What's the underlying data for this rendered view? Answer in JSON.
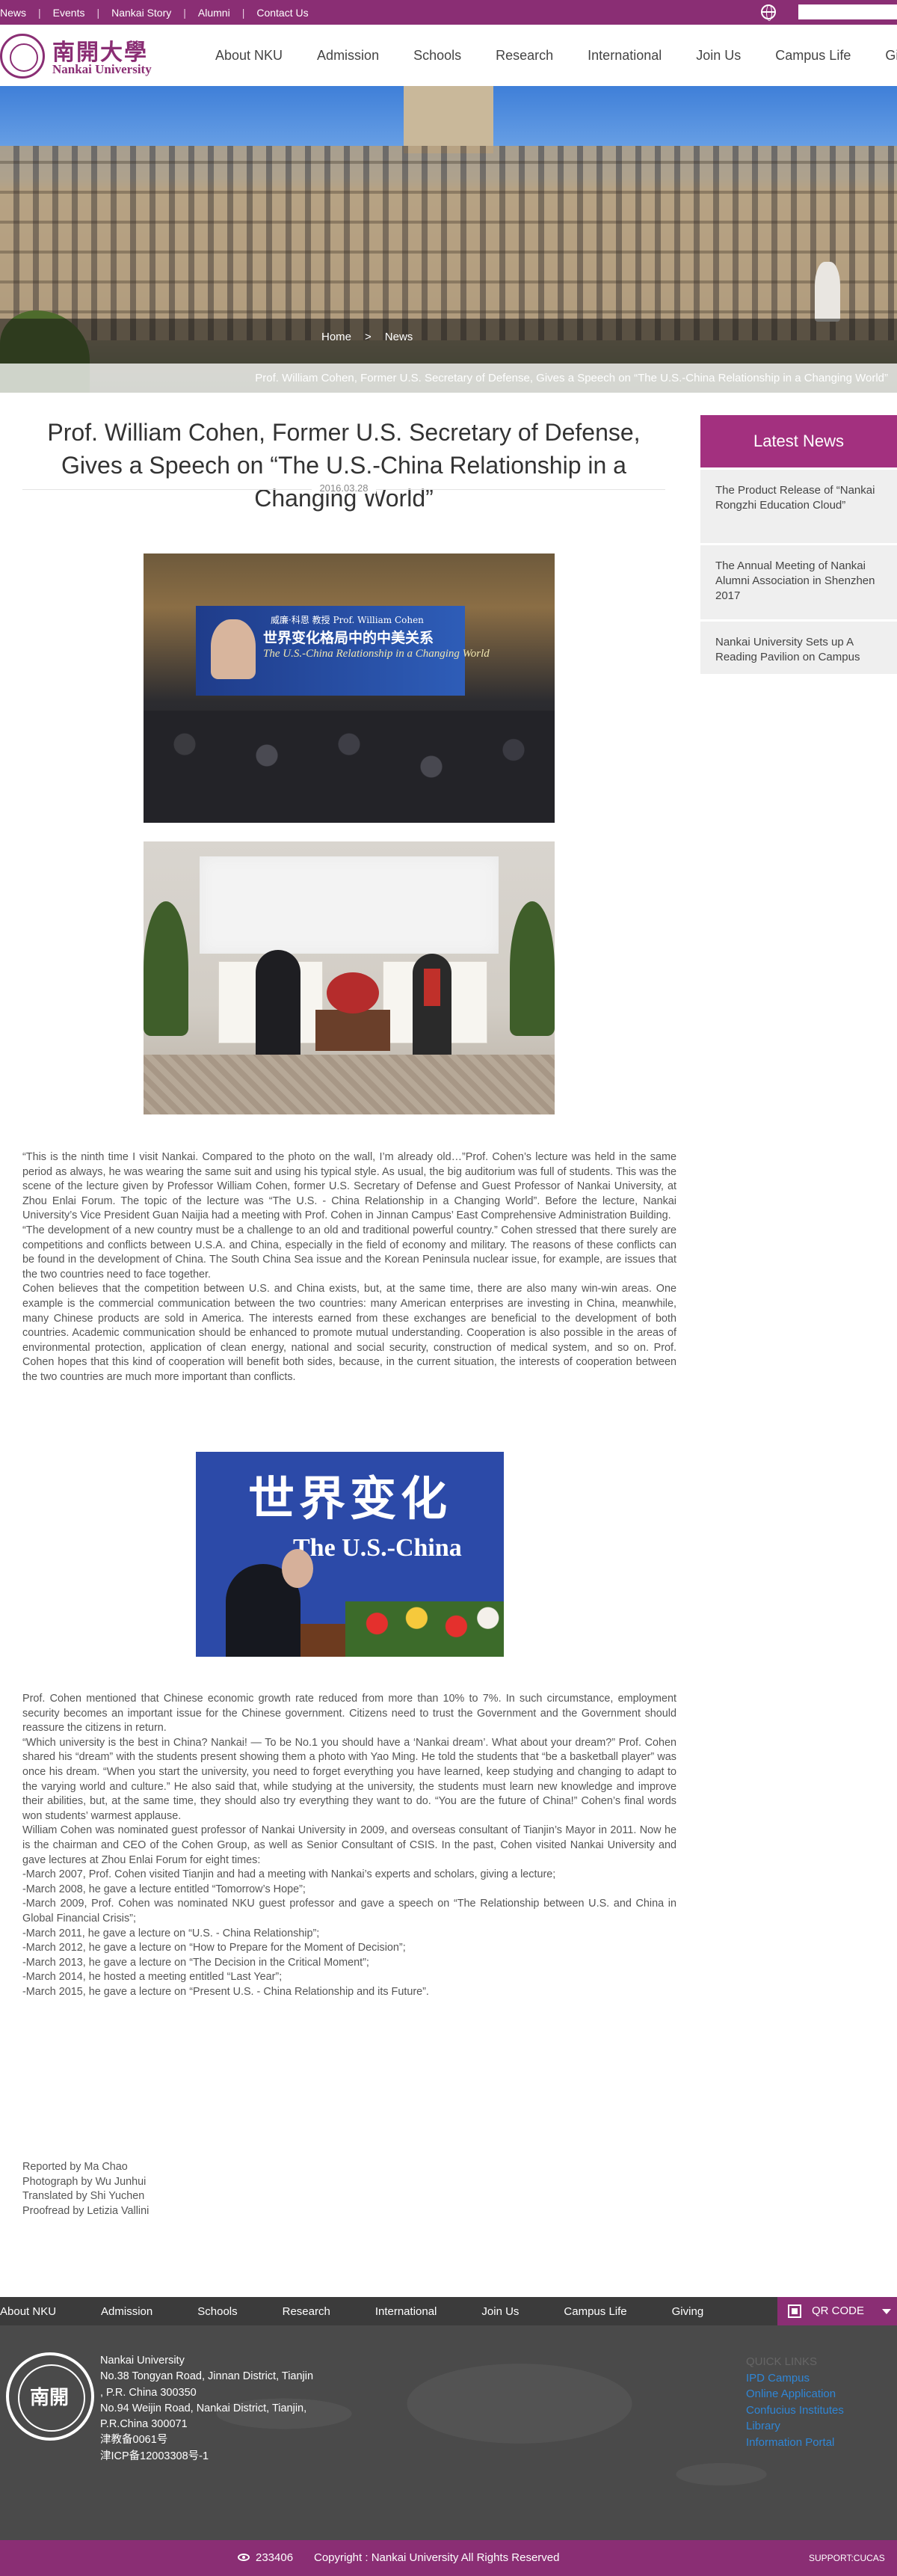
{
  "topbar": {
    "links": [
      "News",
      "Events",
      "Nankai Story",
      "Alumni",
      "Contact Us"
    ],
    "globe_icon": "globe-icon",
    "search_placeholder": ""
  },
  "header": {
    "logo_cn": "南開大學",
    "logo_en": "Nankai University",
    "nav": [
      "About NKU",
      "Admission",
      "Schools",
      "Research",
      "International",
      "Join Us",
      "Campus Life",
      "Giving"
    ]
  },
  "hero": {
    "breadcrumb": [
      "Home",
      ">",
      "News"
    ],
    "ghost_title": "Prof. William Cohen, Former U.S. Secretary of Defense, Gives a Speech on “The U.S.-China Relationship in a Changing World”"
  },
  "article": {
    "title": "Prof. William Cohen, Former U.S. Secretary of Defense, Gives a Speech on “The U.S.-China Relationship in a Changing World”",
    "date": "2016.03.28",
    "photo1_sign_small": "威廉·科恩 教授  Prof. William Cohen",
    "photo1_sign_cn": "世界变化格局中的中美关系",
    "photo1_sign_en": "The U.S.-China Relationship in a Changing World",
    "photo3_cn": "世界变化",
    "photo3_en": "The U.S.-China",
    "paragraphs_1": [
      "“This is the ninth time I visit Nankai. Compared to the photo on the wall, I’m already old…”Prof. Cohen’s lecture was held in the same period as always, he was wearing the same suit and using his typical style. As usual, the big auditorium was full of students. This was the scene of the lecture given by Professor William Cohen, former U.S. Secretary of Defense and Guest Professor of Nankai University, at Zhou Enlai Forum. The topic of the lecture was “The U.S. - China Relationship in a Changing World”. Before the lecture, Nankai University’s Vice President Guan Naijia had a meeting with Prof. Cohen in Jinnan Campus’ East Comprehensive Administration Building.",
      "“The development of a new country must be a challenge to an old and traditional powerful country.” Cohen stressed that there surely are competitions and conflicts between U.S.A. and China, especially in the field of economy and military. The reasons of these conflicts can be found in the development of China. The South China Sea issue and the Korean Peninsula nuclear issue, for example, are issues that the two countries need to face together.",
      "Cohen believes that the competition between U.S. and China exists, but, at the same time, there are also many win-win areas. One example is the commercial communication between the two countries: many American enterprises are investing in China, meanwhile, many Chinese products are sold in America. The interests earned from these exchanges are beneficial to the development of both countries. Academic communication should be enhanced to promote mutual understanding. Cooperation is also possible in the areas of environmental protection, application of clean energy, national and social security, construction of medical system, and so on. Prof. Cohen hopes that this kind of cooperation will benefit both sides, because, in the current situation, the interests of cooperation between the two countries are much more important than conflicts."
    ],
    "paragraphs_2": [
      "Prof. Cohen mentioned that Chinese economic growth rate reduced from more than 10% to 7%. In such circumstance, employment security becomes an important issue for the Chinese government. Citizens need to trust the Government and the Government should reassure the citizens in return.",
      "“Which university is the best in China? Nankai! — To be No.1 you should have a ‘Nankai dream’. What about your dream?” Prof. Cohen shared his “dream” with the students present showing them a photo with Yao Ming. He told the students that “be a basketball player” was once his dream. “When you start the university, you need to forget everything you have learned, keep studying and changing to adapt to the varying world and culture.” He also said that, while studying at the university, the students must learn new knowledge and improve their abilities, but, at the same time, they should also try everything they want to do. “You are the future of China!” Cohen’s final words won students’ warmest applause.",
      "William Cohen was nominated guest professor of Nankai University in 2009, and overseas consultant of Tianjin’s Mayor in 2011. Now he is the chairman and CEO of the Cohen Group, as well as Senior Consultant of CSIS. In the past, Cohen visited Nankai University and gave lectures at Zhou Enlai Forum for eight times:",
      "-March 2007, Prof. Cohen visited Tianjin and had a meeting with Nankai’s experts and scholars, giving a lecture;",
      "-March 2008, he gave a lecture entitled “Tomorrow’s Hope”;",
      "-March 2009, Prof. Cohen was nominated NKU guest professor and gave a speech on “The Relationship between U.S. and China in Global Financial Crisis”;",
      "-March 2011, he gave a lecture on “U.S. - China Relationship”;",
      "-March 2012, he gave a lecture on “How to Prepare for the Moment of Decision”;",
      "-March 2013, he gave a lecture on “The Decision in the Critical Moment”;",
      "-March 2014, he hosted a meeting entitled “Last Year”;",
      "-March 2015, he gave a lecture on “Present U.S. - China Relationship and its Future”."
    ],
    "credits": [
      "Reported by Ma Chao",
      "Photograph by Wu Junhui",
      "Translated by Shi Yuchen",
      "Proofread by Letizia Vallini"
    ]
  },
  "sidebar": {
    "heading": "Latest News",
    "items": [
      "The Product Release of “Nankai Rongzhi Education Cloud”",
      "The Annual Meeting of Nankai Alumni Association in Shenzhen 2017",
      "Nankai University Sets up A Reading Pavilion on Campus"
    ]
  },
  "footer": {
    "nav": [
      "About NKU",
      "Admission",
      "Schools",
      "Research",
      "International",
      "Join Us",
      "Campus Life",
      "Giving"
    ],
    "qr_label": "QR CODE",
    "emblem_text": "南開",
    "address": [
      "Nankai University",
      "No.38 Tongyan Road, Jinnan District, Tianjin",
      ", P.R. China 300350",
      "No.94 Weijin Road, Nankai District, Tianjin,",
      "P.R.China 300071",
      "津教备0061号",
      "津ICP备12003308号-1"
    ],
    "quick_heading": "QUICK LINKS",
    "quick_links": [
      "IPD Campus",
      "Online Application",
      "Confucius Institutes",
      "Library",
      "Information Portal"
    ]
  },
  "bottombar": {
    "visits": "233406",
    "copyright": "Copyright : Nankai University All Rights Reserved",
    "support": "SUPPORT:CUCAS"
  },
  "colors": {
    "brand": "#8a2e74",
    "sidebar_head": "#a3307f",
    "footer_bg": "#4a4a4a",
    "link_blue": "#2f86d6"
  }
}
